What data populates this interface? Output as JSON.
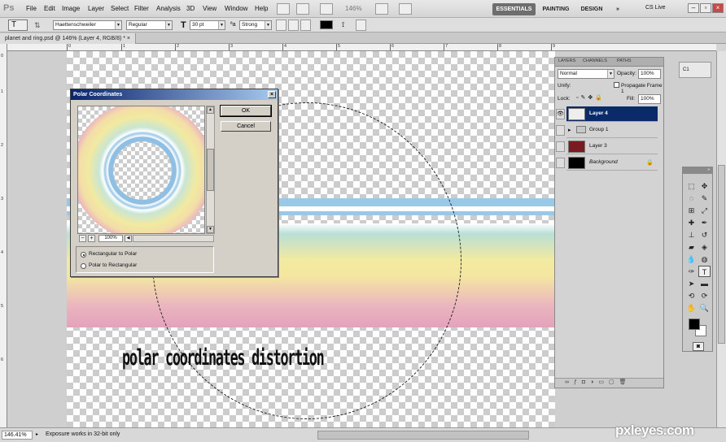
{
  "app": {
    "logo": "Ps"
  },
  "menu": [
    "File",
    "Edit",
    "Image",
    "Layer",
    "Select",
    "Filter",
    "Analysis",
    "3D",
    "View",
    "Window",
    "Help"
  ],
  "topbar": {
    "zoom": "146%",
    "workspaces": [
      "ESSENTIALS",
      "PAINTING",
      "DESIGN"
    ],
    "cslive": "CS Live"
  },
  "options": {
    "tool_glyph": "T",
    "font_family": "Haettenschweiler",
    "font_style": "Regular",
    "font_size": "30 pt",
    "aa_label": "ªa",
    "antialias": "Strong",
    "text_color": "#000000"
  },
  "document": {
    "tab_title": "planet and ring.psd @ 146% (Layer 4, RGB/8) *"
  },
  "rulers": {
    "top": [
      "0",
      "1",
      "2",
      "3",
      "4",
      "5",
      "6",
      "7",
      "8",
      "9"
    ],
    "left": [
      "0",
      "1",
      "2",
      "3",
      "4",
      "5",
      "6"
    ]
  },
  "canvas": {
    "caption": "polar coordinates distortion"
  },
  "status": {
    "zoom": "146.41%",
    "message": "Exposure works in 32-bit only"
  },
  "dialog": {
    "title": "Polar Coordinates",
    "ok": "OK",
    "cancel": "Cancel",
    "zoom": "100%",
    "options": [
      {
        "label": "Rectangular to Polar",
        "selected": true
      },
      {
        "label": "Polar to Rectangular",
        "selected": false
      }
    ]
  },
  "layers_panel": {
    "tabs": [
      "LAYERS",
      "CHANNELS",
      "PATHS"
    ],
    "blend_mode": "Normal",
    "opacity_label": "Opacity:",
    "opacity": "100%",
    "unify_label": "Unify:",
    "propagate": "Propagate Frame 1",
    "lock_label": "Lock:",
    "fill_label": "Fill:",
    "fill": "100%",
    "layers": [
      {
        "name": "Layer 4",
        "selected": true
      },
      {
        "name": "Group 1",
        "selected": false
      },
      {
        "name": "Layer 3",
        "selected": false
      },
      {
        "name": "Background",
        "selected": false
      }
    ]
  },
  "watermark": "pxleyes.com"
}
